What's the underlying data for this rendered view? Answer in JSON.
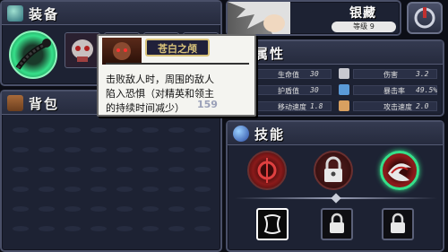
{
  "equipment": {
    "title": "装备"
  },
  "bag": {
    "title": "背包",
    "count": "159"
  },
  "character": {
    "name": "银藏",
    "level": "等级 9"
  },
  "attributes": {
    "title": "属性",
    "stats": [
      {
        "label": "生命值",
        "value": "30",
        "icon": "heart-icon"
      },
      {
        "label": "伤害",
        "value": "3.2",
        "icon": "sword-icon"
      },
      {
        "label": "护盾值",
        "value": "30",
        "icon": "shield-icon"
      },
      {
        "label": "暴击率",
        "value": "49.5%",
        "icon": "eye-icon"
      },
      {
        "label": "移动速度",
        "value": "1.8",
        "icon": "boot-icon"
      },
      {
        "label": "攻击速度",
        "value": "2.0",
        "icon": "fist-icon"
      }
    ]
  },
  "skills": {
    "title": "技能",
    "active": [
      "red-sigil-icon",
      "lock-icon",
      "wolf-swirl-icon"
    ],
    "passive": [
      "scroll-icon",
      "lock-icon",
      "lock-icon"
    ]
  },
  "tooltip": {
    "name": "苍白之颅",
    "line1": "击败敌人时，周围的敌人",
    "line2": "陷入恐惧（对精英和领主",
    "line3": "的持续时间减少）"
  },
  "colors": {
    "accent_green": "#36e08a",
    "panel": "#1d2233",
    "border": "#4a5068",
    "tooltip_gold": "#d8c27a"
  }
}
